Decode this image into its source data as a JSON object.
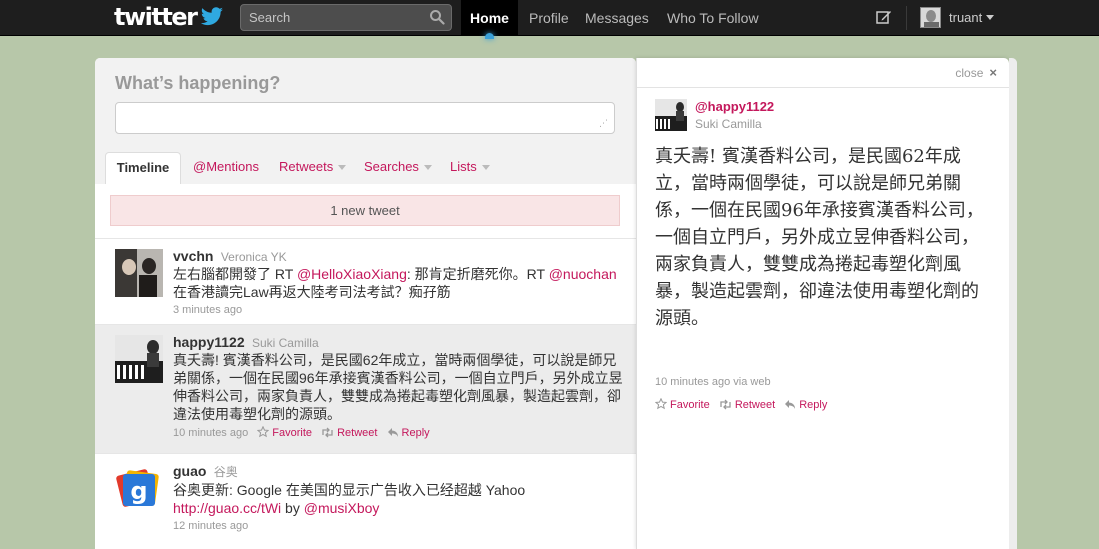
{
  "topbar": {
    "logo_text": "twitter",
    "search_placeholder": "Search",
    "nav": {
      "home": "Home",
      "profile": "Profile",
      "messages": "Messages",
      "who_to_follow": "Who To Follow"
    },
    "username": "truant"
  },
  "compose": {
    "prompt": "What’s happening?"
  },
  "tabs": {
    "timeline": "Timeline",
    "mentions": "@Mentions",
    "retweets": "Retweets",
    "searches": "Searches",
    "lists": "Lists"
  },
  "stream": {
    "new_tweets": "1 new tweet",
    "actions": {
      "favorite": "Favorite",
      "retweet": "Retweet",
      "reply": "Reply"
    },
    "tweets": [
      {
        "screen_name": "vvchn",
        "full_name": "Veronica YK",
        "text_1": "左右腦都開發了 RT ",
        "mention_1": "@HelloXiaoXiang",
        "text_2": ": 那肯定折磨死你。RT ",
        "mention_2": "@nuochan",
        "text_3": " 在香港讀完Law再返大陸考司法考試？痴孖筋",
        "time": "3 minutes ago"
      },
      {
        "screen_name": "happy1122",
        "full_name": "Suki Camilla",
        "text": "真夭壽! 賓漢香料公司，是民國62年成立，當時兩個學徒，可以說是師兄弟關係，一個在民國96年承接賓漢香料公司，一個自立門戶，另外成立昱伸香料公司，兩家負責人，雙雙成為捲起毒塑化劑風暴，製造起雲劑，卻違法使用毒塑化劑的源頭。",
        "time": "10 minutes ago"
      },
      {
        "screen_name": "guao",
        "full_name": "谷奥",
        "text_1": "谷奥更新: Google 在美国的显示广告收入已经超越 Yahoo",
        "link": "http://guao.cc/tWi",
        "text_2": " by ",
        "mention": "@musiXboy",
        "time": "12 minutes ago"
      }
    ]
  },
  "detail": {
    "close": "close",
    "close_x": "×",
    "screen_name": "@happy1122",
    "full_name": "Suki Camilla",
    "text": "真夭壽! 賓漢香料公司，是民國62年成立，當時兩個學徒，可以說是師兄弟關係，一個在民國96年承接賓漢香料公司，一個自立門戶，另外成立昱伸香料公司，兩家負責人，雙雙成為捲起毒塑化劑風暴，製造起雲劑，卻違法使用毒塑化劑的源頭。",
    "time": "10 minutes ago",
    "via": " via web",
    "actions": {
      "favorite": "Favorite",
      "retweet": "Retweet",
      "reply": "Reply"
    }
  },
  "colors": {
    "link": "#c4185c",
    "topbar": "#1e1e1e",
    "background": "#b7c7a9",
    "new_tweet_bar": "#f9e5e6"
  },
  "icons": [
    "bird-logo-icon",
    "search-icon",
    "compose-icon",
    "user-caret-icon",
    "star-icon",
    "retweet-icon",
    "reply-icon",
    "close-icon",
    "resize-grip-icon"
  ]
}
